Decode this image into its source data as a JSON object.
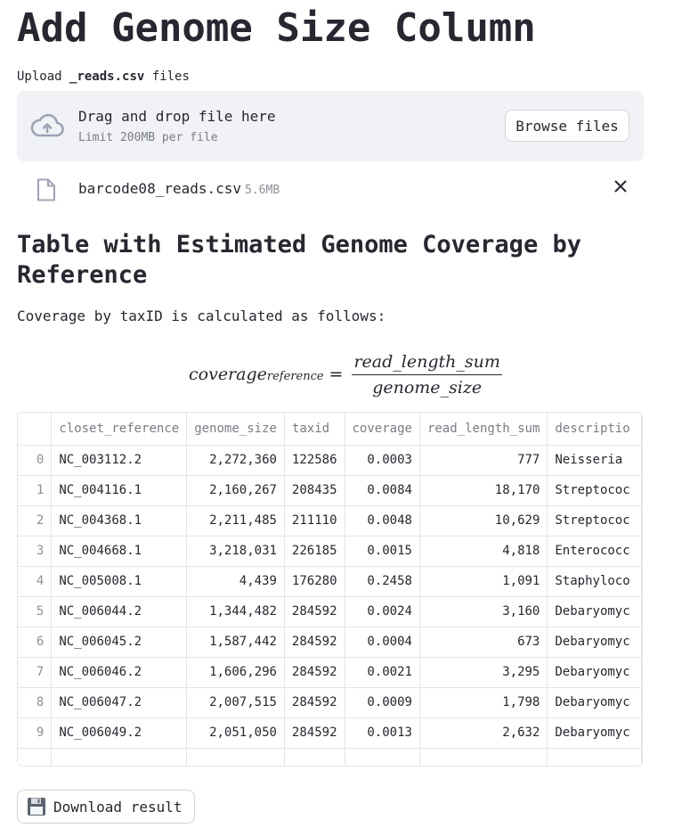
{
  "title": "Add Genome Size Column",
  "uploader": {
    "label_prefix": "Upload ",
    "label_bold": "_reads.csv",
    "label_suffix": " files",
    "drop_text": "Drag and drop file here",
    "limit_text": "Limit 200MB per file",
    "browse_label": "Browse files",
    "icon": "cloud-upload-icon"
  },
  "uploaded_file": {
    "name": "barcode08_reads.csv",
    "size": "5.6MB",
    "icon": "file-icon",
    "remove_icon": "close-icon"
  },
  "section_heading": "Table with Estimated Genome Coverage by Reference",
  "description": "Coverage by taxID is calculated as follows:",
  "formula": {
    "lhs": "coverage",
    "lhs_sub": "reference",
    "eq": "=",
    "numerator": "read_length_sum",
    "denominator": "genome_size"
  },
  "table": {
    "columns": [
      "",
      "closet_reference",
      "genome_size",
      "taxid",
      "coverage",
      "read_length_sum",
      "descriptio"
    ],
    "rows": [
      [
        "0",
        "NC_003112.2",
        "2,272,360",
        "122586",
        "0.0003",
        "777",
        "Neisseria"
      ],
      [
        "1",
        "NC_004116.1",
        "2,160,267",
        "208435",
        "0.0084",
        "18,170",
        "Streptococ"
      ],
      [
        "2",
        "NC_004368.1",
        "2,211,485",
        "211110",
        "0.0048",
        "10,629",
        "Streptococ"
      ],
      [
        "3",
        "NC_004668.1",
        "3,218,031",
        "226185",
        "0.0015",
        "4,818",
        "Enterococc"
      ],
      [
        "4",
        "NC_005008.1",
        "4,439",
        "176280",
        "0.2458",
        "1,091",
        "Staphyloco"
      ],
      [
        "5",
        "NC_006044.2",
        "1,344,482",
        "284592",
        "0.0024",
        "3,160",
        "Debaryomyc"
      ],
      [
        "6",
        "NC_006045.2",
        "1,587,442",
        "284592",
        "0.0004",
        "673",
        "Debaryomyc"
      ],
      [
        "7",
        "NC_006046.2",
        "1,606,296",
        "284592",
        "0.0021",
        "3,295",
        "Debaryomyc"
      ],
      [
        "8",
        "NC_006047.2",
        "2,007,515",
        "284592",
        "0.0009",
        "1,798",
        "Debaryomyc"
      ],
      [
        "9",
        "NC_006049.2",
        "2,051,050",
        "284592",
        "0.0013",
        "2,632",
        "Debaryomyc"
      ]
    ]
  },
  "download": {
    "label": "Download result",
    "icon": "floppy-disk-icon"
  }
}
